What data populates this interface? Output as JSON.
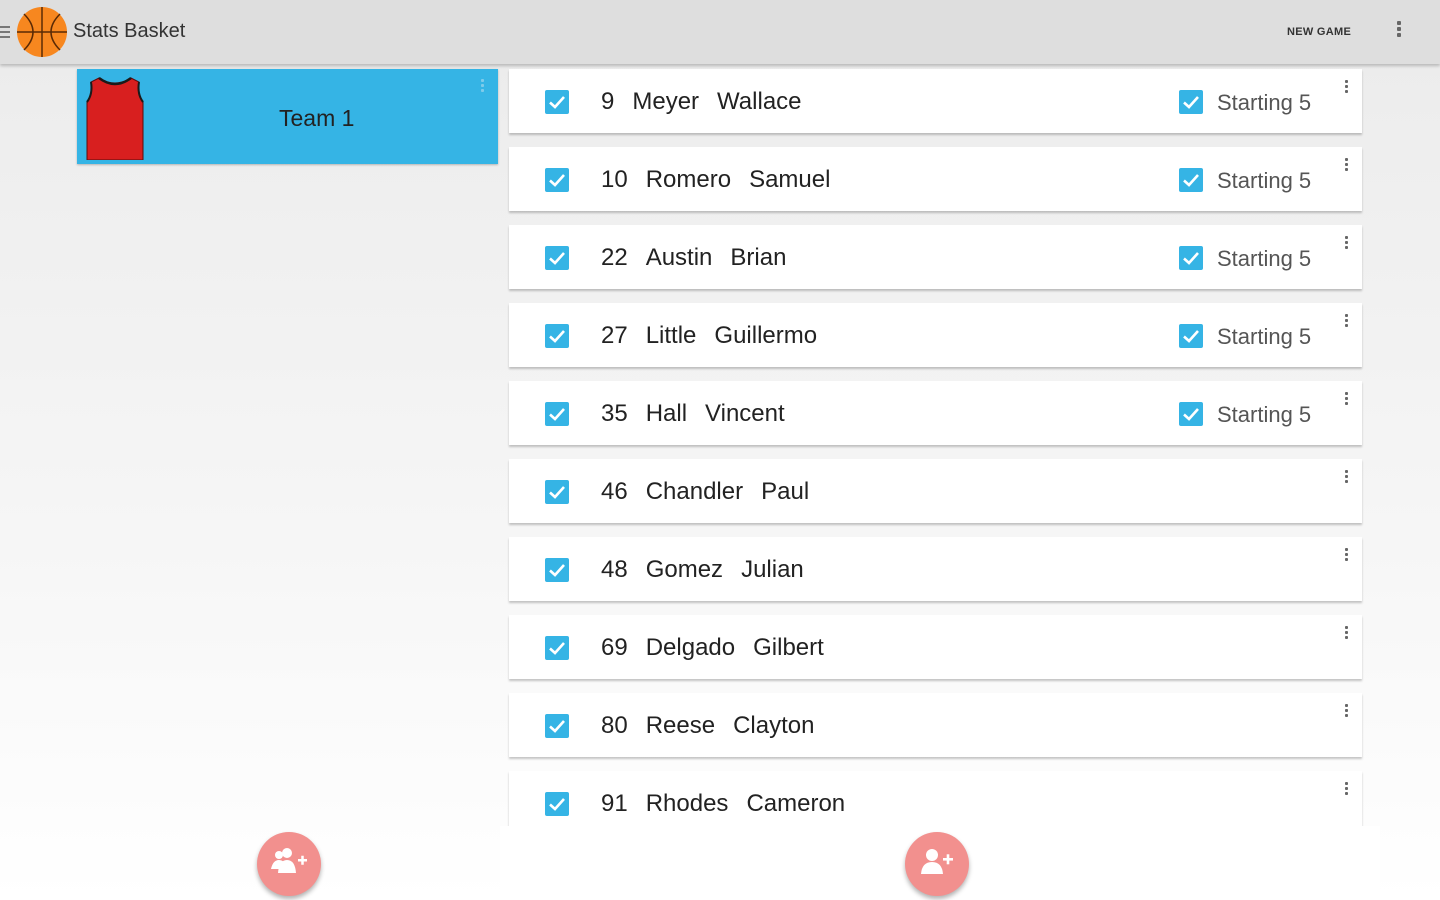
{
  "actionbar": {
    "title": "Stats Basket",
    "new_game_label": "NEW GAME",
    "logo_icon": "basketball-icon",
    "accent": "#35b4e5"
  },
  "team": {
    "name": "Team 1",
    "jersey_color": "#d81f1f",
    "card_color": "#35b4e5"
  },
  "players": [
    {
      "number": "9",
      "last": "Meyer",
      "first": "Wallace",
      "selected": true,
      "starting": true
    },
    {
      "number": "10",
      "last": "Romero",
      "first": "Samuel",
      "selected": true,
      "starting": true
    },
    {
      "number": "22",
      "last": "Austin",
      "first": "Brian",
      "selected": true,
      "starting": true
    },
    {
      "number": "27",
      "last": "Little",
      "first": "Guillermo",
      "selected": true,
      "starting": true
    },
    {
      "number": "35",
      "last": "Hall",
      "first": "Vincent",
      "selected": true,
      "starting": true
    },
    {
      "number": "46",
      "last": "Chandler",
      "first": "Paul",
      "selected": true,
      "starting": false
    },
    {
      "number": "48",
      "last": "Gomez",
      "first": "Julian",
      "selected": true,
      "starting": false
    },
    {
      "number": "69",
      "last": "Delgado",
      "first": "Gilbert",
      "selected": true,
      "starting": false
    },
    {
      "number": "80",
      "last": "Reese",
      "first": "Clayton",
      "selected": true,
      "starting": false
    },
    {
      "number": "91",
      "last": "Rhodes",
      "first": "Cameron",
      "selected": true,
      "starting": false
    }
  ],
  "starting_label": "Starting 5",
  "fabs": {
    "add_team_icon": "add-group-icon",
    "add_player_icon": "add-person-icon",
    "color": "#f2908e"
  }
}
